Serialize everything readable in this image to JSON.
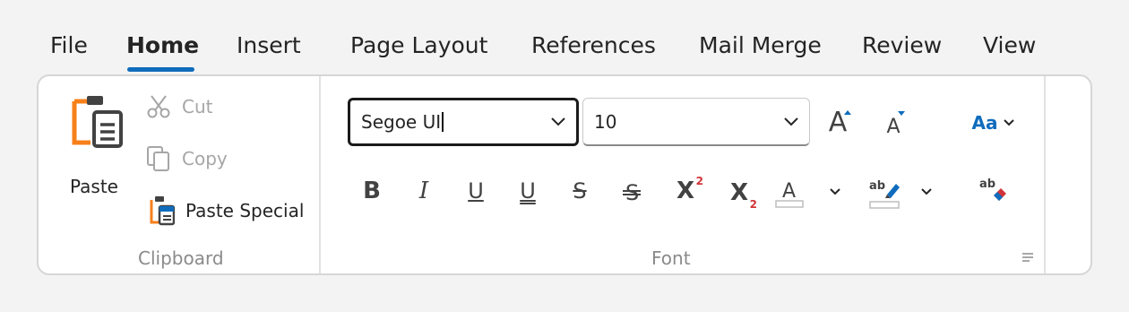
{
  "tabs": [
    {
      "label": "File"
    },
    {
      "label": "Home"
    },
    {
      "label": "Insert"
    },
    {
      "label": "Page Layout"
    },
    {
      "label": "References"
    },
    {
      "label": "Mail Merge"
    },
    {
      "label": "Review"
    },
    {
      "label": "View"
    }
  ],
  "clipboard": {
    "group_label": "Clipboard",
    "paste_label": "Paste",
    "cut_label": "Cut",
    "copy_label": "Copy",
    "paste_special_label": "Paste Special"
  },
  "font": {
    "group_label": "Font",
    "font_name": "Segoe UI",
    "font_size": "10",
    "change_case_label": "Aa",
    "superscript_mark": "2",
    "subscript_mark": "2"
  },
  "colors": {
    "accent": "#0f6cbd",
    "paste_orange": "#f7801a",
    "red_mark": "#d13438",
    "disabled_text": "#a6a6a6"
  }
}
